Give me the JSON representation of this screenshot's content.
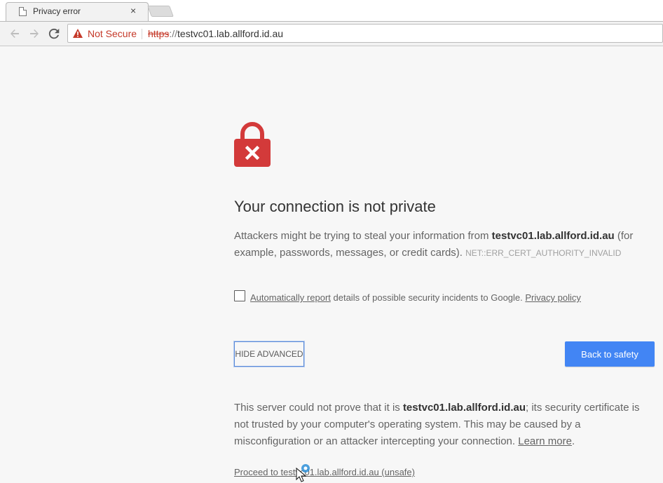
{
  "tab": {
    "title": "Privacy error",
    "close": "×"
  },
  "omnibox": {
    "security_label": "Not Secure",
    "url_scheme": "https",
    "url_slashes": "://",
    "url_host": "testvc01.lab.allford.id.au"
  },
  "interstitial": {
    "heading": "Your connection is not private",
    "desc_prefix": "Attackers might be trying to steal your information from ",
    "desc_host": "testvc01.lab.allford.id.au",
    "desc_suffix": " (for example, passwords, messages, or credit cards). ",
    "error_code": "NET::ERR_CERT_AUTHORITY_INVALID",
    "report_link": "Automatically report",
    "report_text": " details of possible security incidents to Google. ",
    "privacy_policy": "Privacy policy",
    "advanced_button": "HIDE ADVANCED",
    "safety_button": "Back to safety",
    "detail_prefix": "This server could not prove that it is ",
    "detail_host": "testvc01.lab.allford.id.au",
    "detail_suffix": "; its security certificate is not trusted by your computer's operating system. This may be caused by a misconfiguration or an attacker intercepting your connection. ",
    "learn_more": "Learn more",
    "learn_more_end": ".",
    "proceed_link": "Proceed to testvc01.lab.allford.id.au (unsafe)"
  },
  "colors": {
    "accent_blue": "#4285f4",
    "warning_red": "#c53929",
    "lock_red": "#d33a3a"
  },
  "icons": [
    "page-icon",
    "back-arrow-icon",
    "forward-arrow-icon",
    "reload-icon",
    "warning-triangle-icon",
    "lock-error-icon",
    "mouse-cursor-icon"
  ]
}
